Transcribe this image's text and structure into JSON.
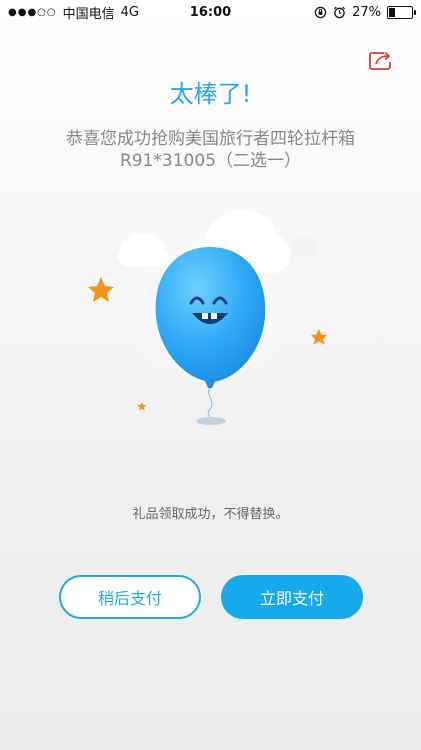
{
  "status_bar": {
    "signal": "●●●○○",
    "carrier": "中国电信",
    "network": "4G",
    "time": "16:00",
    "battery_percent": "27%",
    "battery_level": 0.27
  },
  "header": {
    "share_icon": "share-icon",
    "title": "太棒了!"
  },
  "product": {
    "line1": "恭喜您成功抢购美国旅行者四轮拉杆箱",
    "line2": "R91*31005（二选一）"
  },
  "illustration": {
    "subject": "balloon-mascot",
    "colors": {
      "balloon": "#2ea9f6",
      "star": "#f5921d",
      "cloud": "#ffffff"
    }
  },
  "message": "礼品领取成功，不得替换。",
  "actions": {
    "later_label": "稍后支付",
    "pay_label": "立即支付"
  },
  "colors": {
    "accent": "#16a9ec",
    "title": "#2aa4f4"
  }
}
